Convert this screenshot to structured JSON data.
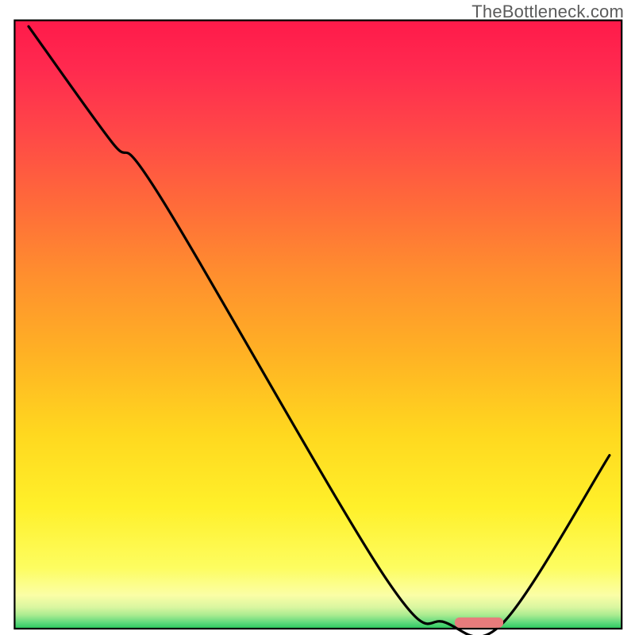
{
  "watermark": "TheBottleneck.com",
  "chart_data": {
    "type": "line",
    "title": "",
    "xlabel": "",
    "ylabel": "",
    "xlim": [
      0,
      100
    ],
    "ylim": [
      0,
      100
    ],
    "curve": [
      {
        "x": 2.3,
        "y": 99.0
      },
      {
        "x": 16.0,
        "y": 80.0
      },
      {
        "x": 24.0,
        "y": 71.0
      },
      {
        "x": 61.0,
        "y": 8.5
      },
      {
        "x": 71.0,
        "y": 1.0
      },
      {
        "x": 80.5,
        "y": 1.0
      },
      {
        "x": 98.0,
        "y": 28.5
      }
    ],
    "marker_bar": {
      "x_start": 72.5,
      "x_end": 80.5,
      "y": 1.0,
      "color": "#e77c7c"
    },
    "axes": {
      "frame_rect": {
        "x": 2.3,
        "y": 3.2,
        "w": 95.6,
        "h": 95.8
      },
      "frame_stroke": "#000000",
      "frame_stroke_width": 2.2
    },
    "gradient_stops": [
      {
        "offset": 0.0,
        "color": "#ff1a4a"
      },
      {
        "offset": 0.08,
        "color": "#ff2a4f"
      },
      {
        "offset": 0.18,
        "color": "#ff4648"
      },
      {
        "offset": 0.3,
        "color": "#ff6a3a"
      },
      {
        "offset": 0.42,
        "color": "#ff8f2e"
      },
      {
        "offset": 0.55,
        "color": "#ffb224"
      },
      {
        "offset": 0.68,
        "color": "#ffd81f"
      },
      {
        "offset": 0.8,
        "color": "#fff02a"
      },
      {
        "offset": 0.9,
        "color": "#fdfd60"
      },
      {
        "offset": 0.945,
        "color": "#fbfea6"
      },
      {
        "offset": 0.965,
        "color": "#d9f6a0"
      },
      {
        "offset": 0.978,
        "color": "#a9eb90"
      },
      {
        "offset": 0.99,
        "color": "#5fd97c"
      },
      {
        "offset": 1.0,
        "color": "#29c95f"
      }
    ]
  }
}
